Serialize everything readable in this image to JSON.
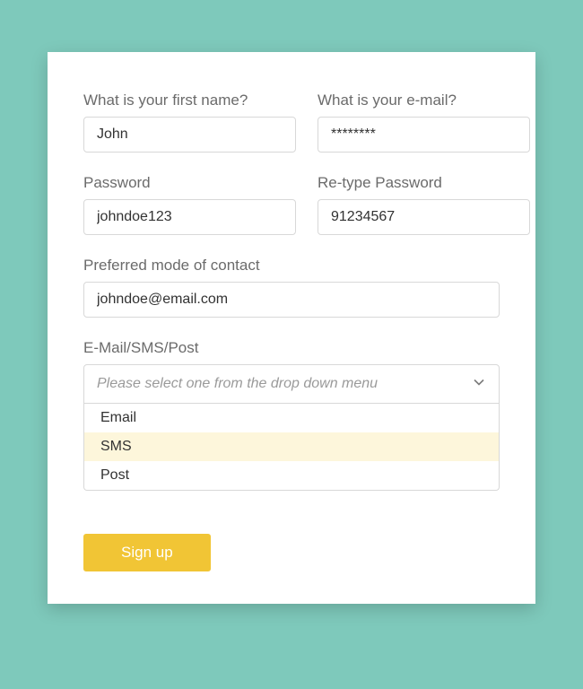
{
  "fields": {
    "first_name": {
      "label": "What is your first name?",
      "value": "John"
    },
    "email": {
      "label": "What is your e-mail?",
      "value": "********"
    },
    "password": {
      "label": "Password",
      "value": "johndoe123"
    },
    "retype_password": {
      "label": "Re-type Password",
      "value": "91234567"
    },
    "preferred_contact": {
      "label": "Preferred mode of contact",
      "value": "johndoe@email.com"
    }
  },
  "dropdown": {
    "label": "E-Mail/SMS/Post",
    "placeholder": "Please select one from the drop down menu",
    "options": [
      "Email",
      "SMS",
      "Post"
    ],
    "highlighted_index": 1
  },
  "actions": {
    "signup_label": "Sign up"
  },
  "colors": {
    "page_bg": "#7ec9bb",
    "accent": "#f1c535",
    "highlight_row": "#fdf6db"
  }
}
